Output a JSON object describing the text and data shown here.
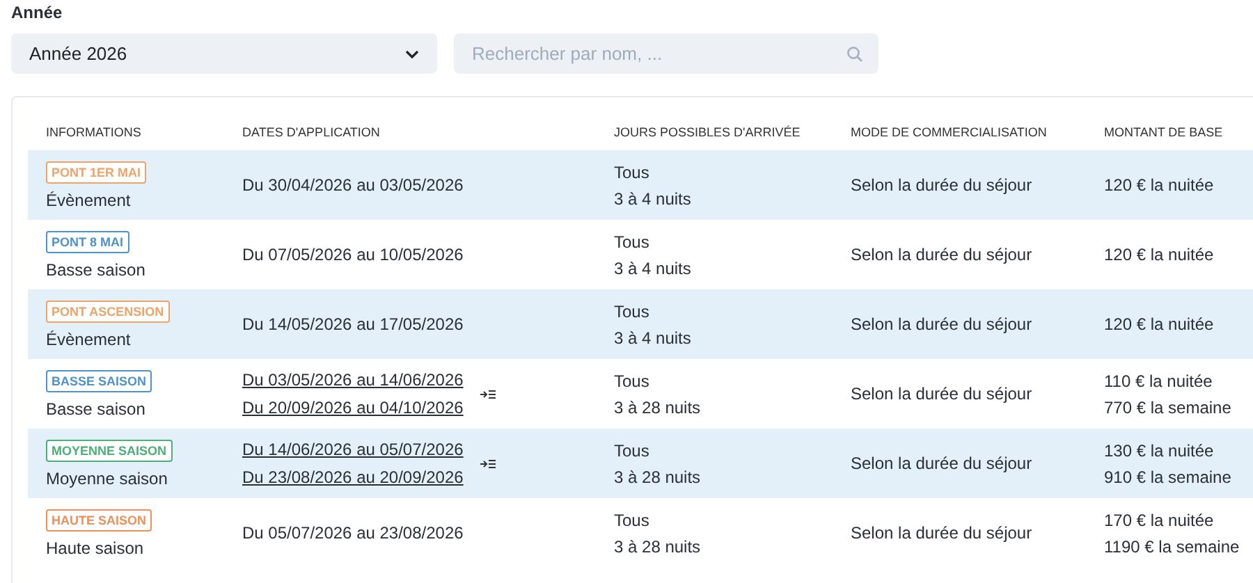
{
  "year_filter": {
    "label": "Année",
    "value": "Année 2026"
  },
  "search": {
    "placeholder": "Rechercher par nom, ..."
  },
  "table": {
    "columns": [
      "INFORMATIONS",
      "DATES D'APPLICATION",
      "JOURS POSSIBLES D'ARRIVÉE",
      "MODE DE COMMERCIALISATION",
      "MONTANT DE BASE"
    ],
    "rows": [
      {
        "tag": "PONT 1ER MAI",
        "color": "#eba46a",
        "category": "Évènement",
        "dates": [
          "Du 30/04/2026 au 03/05/2026"
        ],
        "days": "Tous",
        "nights": "3 à 4 nuits",
        "mode": "Selon la durée du séjour",
        "prices": [
          "120 € la nuitée"
        ]
      },
      {
        "tag": "PONT 8 MAI",
        "color": "#4f93c9",
        "category": "Basse saison",
        "dates": [
          "Du 07/05/2026 au 10/05/2026"
        ],
        "days": "Tous",
        "nights": "3 à 4 nuits",
        "mode": "Selon la durée du séjour",
        "prices": [
          "120 € la nuitée"
        ]
      },
      {
        "tag": "PONT ASCENSION",
        "color": "#eba46a",
        "category": "Évènement",
        "dates": [
          "Du 14/05/2026 au 17/05/2026"
        ],
        "days": "Tous",
        "nights": "3 à 4 nuits",
        "mode": "Selon la durée du séjour",
        "prices": [
          "120 € la nuitée"
        ]
      },
      {
        "tag": "BASSE SAISON",
        "color": "#4f93c9",
        "category": "Basse saison",
        "dates": [
          "Du 03/05/2026 au 14/06/2026",
          "Du 20/09/2026 au 04/10/2026"
        ],
        "days": "Tous",
        "nights": "3 à 28 nuits",
        "mode": "Selon la durée du séjour",
        "prices": [
          "110 € la nuitée",
          "770 € la semaine"
        ]
      },
      {
        "tag": "MOYENNE SAISON",
        "color": "#4caf78",
        "category": "Moyenne saison",
        "dates": [
          "Du 14/06/2026 au 05/07/2026",
          "Du 23/08/2026 au 20/09/2026"
        ],
        "days": "Tous",
        "nights": "3 à 28 nuits",
        "mode": "Selon la durée du séjour",
        "prices": [
          "130 € la nuitée",
          "910 € la semaine"
        ]
      },
      {
        "tag": "HAUTE SAISON",
        "color": "#e8915a",
        "category": "Haute saison",
        "dates": [
          "Du 05/07/2026 au 23/08/2026"
        ],
        "days": "Tous",
        "nights": "3 à 28 nuits",
        "mode": "Selon la durée du séjour",
        "prices": [
          "170 € la nuitée",
          "1190 € la semaine"
        ]
      }
    ]
  }
}
